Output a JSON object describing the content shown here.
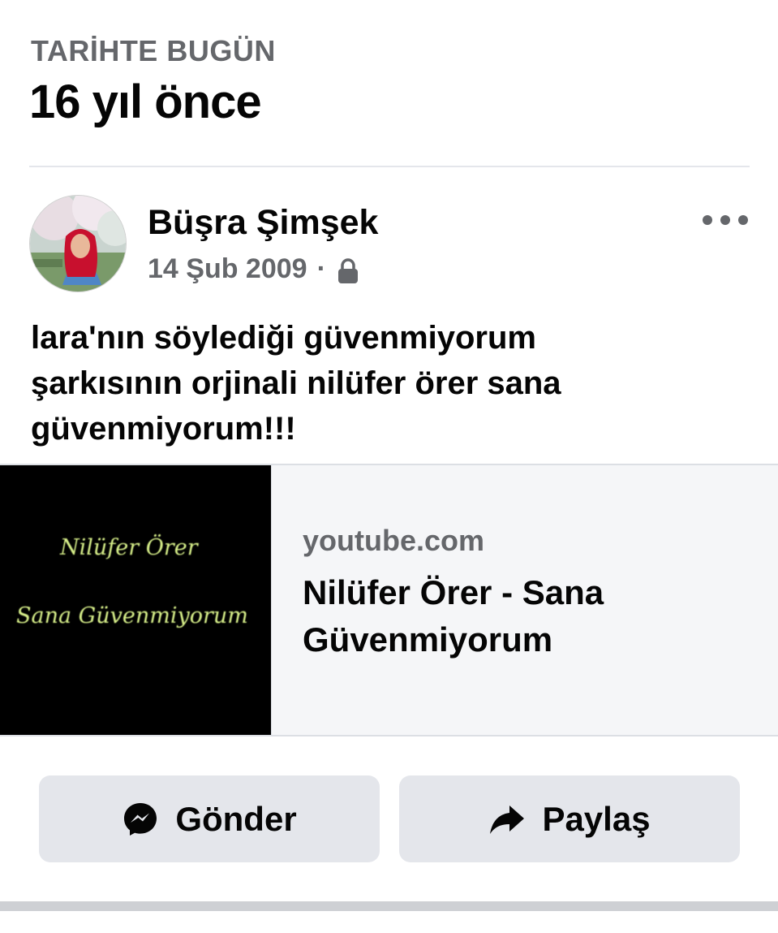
{
  "section": {
    "label": "TARİHTE BUGÜN",
    "title": "16 yıl önce"
  },
  "post": {
    "author": "Büşra Şimşek",
    "date": "14 Şub 2009",
    "separator": "·",
    "privacy_icon": "lock-icon",
    "more_icon": "more-options-icon",
    "text_lines": [
      "lara'nın söylediği güvenmiyorum",
      "şarkısının orjinali nilüfer örer sana",
      "güvenmiyorum!!!"
    ]
  },
  "link": {
    "domain": "youtube.com",
    "title": "Nilüfer Örer - Sana Güvenmiyorum",
    "thumbnail_text_1": "Nilüfer Örer",
    "thumbnail_text_2": "Sana Güvenmiyorum"
  },
  "actions": {
    "send_label": "Gönder",
    "send_icon": "messenger-icon",
    "share_label": "Paylaş",
    "share_icon": "share-arrow-icon"
  },
  "colors": {
    "secondary_text": "#65676b",
    "button_bg": "#e4e6eb",
    "thumbnail_text": "#d8f08a"
  }
}
